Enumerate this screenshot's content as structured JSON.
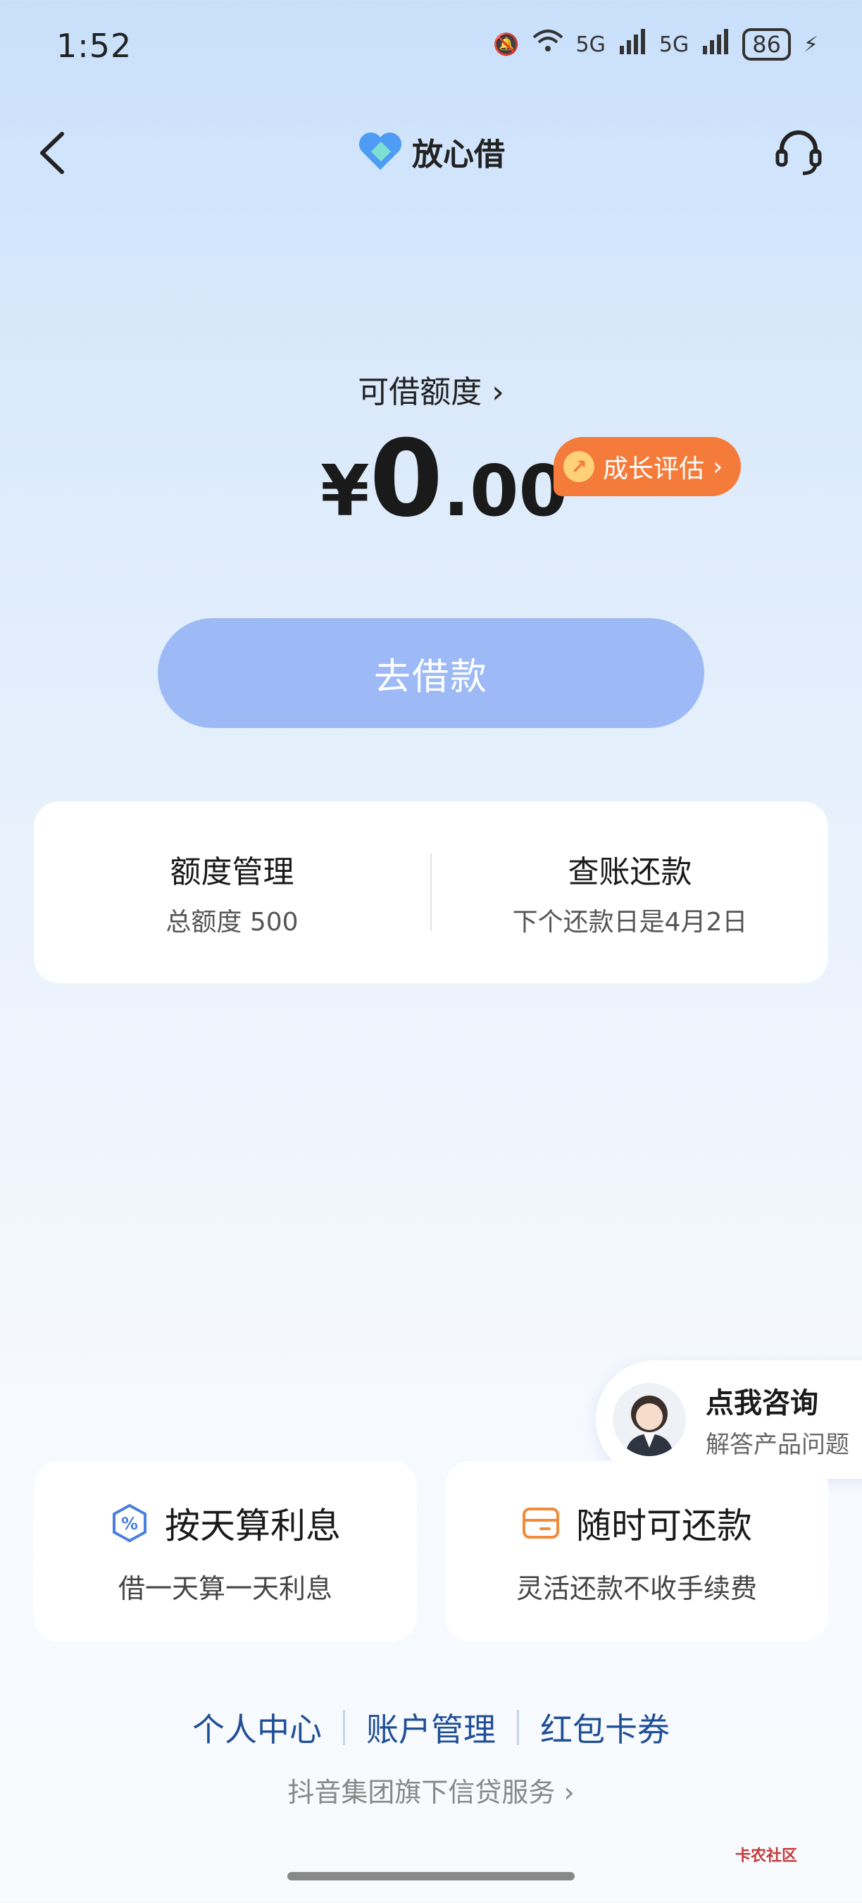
{
  "status_bar": {
    "time": "1:52",
    "network_1": "5G",
    "network_2": "5G",
    "battery": "86"
  },
  "header": {
    "brand": "放心借",
    "back_icon": "chevron-left-icon",
    "service_icon": "headset-icon"
  },
  "credit": {
    "label": "可借额度",
    "currency": "¥",
    "amount_int": "0",
    "amount_dec": ".00",
    "growth_label": "成长评估"
  },
  "borrow_button": "去借款",
  "info_card": {
    "left_title": "额度管理",
    "left_sub": "总额度 500",
    "right_title": "查账还款",
    "right_sub": "下个还款日是4月2日"
  },
  "consult": {
    "title": "点我咨询",
    "sub": "解答产品问题"
  },
  "features": [
    {
      "title": "按天算利息",
      "sub": "借一天算一天利息",
      "icon": "percent-icon",
      "color": "#4a7fe0"
    },
    {
      "title": "随时可还款",
      "sub": "灵活还款不收手续费",
      "icon": "wallet-icon",
      "color": "#f08a3c"
    }
  ],
  "links": [
    "个人中心",
    "账户管理",
    "红包卡券"
  ],
  "footer_note": "抖音集团旗下信贷服务",
  "watermark": "卡农社区",
  "colors": {
    "accent": "#9dbaf6",
    "badge": "#f47b3a",
    "link": "#1f4f96"
  }
}
